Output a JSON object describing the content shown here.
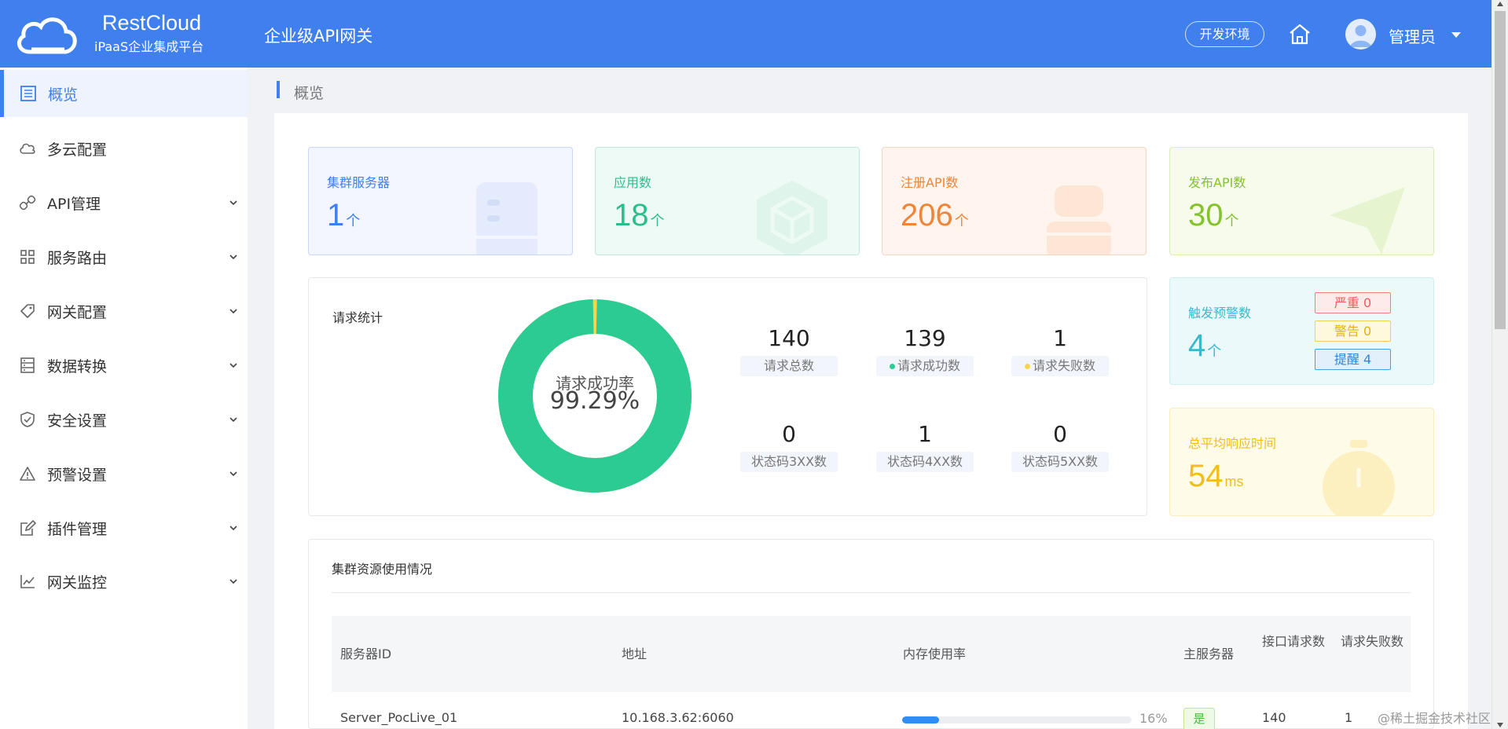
{
  "header": {
    "brand_name": "RestCloud",
    "brand_sub": "iPaaS企业集成平台",
    "app_title": "企业级API网关",
    "env_label": "开发环境",
    "user_name": "管理员"
  },
  "sidebar": {
    "items": [
      {
        "label": "概览",
        "icon": "overview-icon",
        "expandable": false,
        "active": true
      },
      {
        "label": "多云配置",
        "icon": "cloud-icon",
        "expandable": false,
        "active": false
      },
      {
        "label": "API管理",
        "icon": "link-icon",
        "expandable": true,
        "active": false
      },
      {
        "label": "服务路由",
        "icon": "grid-icon",
        "expandable": true,
        "active": false
      },
      {
        "label": "网关配置",
        "icon": "tag-icon",
        "expandable": true,
        "active": false
      },
      {
        "label": "数据转换",
        "icon": "server-icon",
        "expandable": true,
        "active": false
      },
      {
        "label": "安全设置",
        "icon": "shield-icon",
        "expandable": true,
        "active": false
      },
      {
        "label": "预警设置",
        "icon": "warning-icon",
        "expandable": true,
        "active": false
      },
      {
        "label": "插件管理",
        "icon": "edit-icon",
        "expandable": true,
        "active": false
      },
      {
        "label": "网关监控",
        "icon": "line-chart-icon",
        "expandable": true,
        "active": false
      }
    ]
  },
  "breadcrumb": "概览",
  "stats": [
    {
      "label": "集群服务器",
      "value": "1",
      "unit": "个",
      "color": "#3f7fee",
      "bg": "#f3f6fe",
      "border": "#c8d6f7"
    },
    {
      "label": "应用数",
      "value": "18",
      "unit": "个",
      "color": "#2bbd8b",
      "bg": "#eefaf5",
      "border": "#bfe9d8"
    },
    {
      "label": "注册API数",
      "value": "206",
      "unit": "个",
      "color": "#f08537",
      "bg": "#fff5ee",
      "border": "#f8d6bd"
    },
    {
      "label": "发布API数",
      "value": "30",
      "unit": "个",
      "color": "#84c32b",
      "bg": "#f6fbec",
      "border": "#d9edb7"
    }
  ],
  "requests": {
    "title": "请求统计",
    "success_rate_label": "请求成功率",
    "success_rate": "99.29%",
    "success_fraction": 0.9929,
    "metrics": [
      {
        "value": "140",
        "label": "请求总数",
        "dot": null
      },
      {
        "value": "139",
        "label": "请求成功数",
        "dot": "#2bcb93"
      },
      {
        "value": "1",
        "label": "请求失败数",
        "dot": "#f5d64a"
      },
      {
        "value": "0",
        "label": "状态码3XX数",
        "dot": null
      },
      {
        "value": "1",
        "label": "状态码4XX数",
        "dot": null
      },
      {
        "value": "0",
        "label": "状态码5XX数",
        "dot": null
      }
    ]
  },
  "alerts": {
    "label": "触发预警数",
    "value": "4",
    "unit": "个",
    "tags": [
      {
        "label": "严重 0",
        "color": "#f05b5b",
        "bg": "#fdeaea",
        "border": "#f08080"
      },
      {
        "label": "警告 0",
        "color": "#e3b118",
        "bg": "#fef8dc",
        "border": "#f1cf5a"
      },
      {
        "label": "提醒 4",
        "color": "#2f85d6",
        "bg": "#e2f0fb",
        "border": "#4c9fe0"
      }
    ]
  },
  "response": {
    "label": "总平均响应时间",
    "value": "54",
    "unit": "ms"
  },
  "cluster": {
    "title": "集群资源使用情况",
    "headers": [
      "服务器ID",
      "地址",
      "内存使用率",
      "主服务器",
      "接口请求数",
      "请求失败数"
    ],
    "rows": [
      {
        "id": "Server_PocLive_01",
        "address": "10.168.3.62:6060",
        "memory_percent": 16,
        "memory_label": "16%",
        "primary": "是",
        "requests": "140",
        "failures": "1"
      }
    ]
  },
  "watermark": "@稀土掘金技术社区"
}
